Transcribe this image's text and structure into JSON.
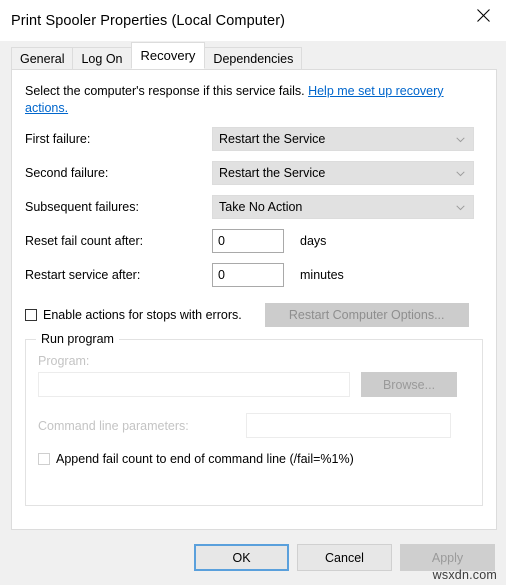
{
  "window": {
    "title": "Print Spooler Properties (Local Computer)",
    "close_icon": "close-icon"
  },
  "tabs": [
    {
      "label": "General",
      "active": false
    },
    {
      "label": "Log On",
      "active": false
    },
    {
      "label": "Recovery",
      "active": true
    },
    {
      "label": "Dependencies",
      "active": false
    }
  ],
  "intro": {
    "text": "Select the computer's response if this service fails.",
    "link": "Help me set up recovery actions."
  },
  "fields": {
    "first_failure": {
      "label": "First failure:",
      "value": "Restart the Service"
    },
    "second_failure": {
      "label": "Second failure:",
      "value": "Restart the Service"
    },
    "subsequent_failures": {
      "label": "Subsequent failures:",
      "value": "Take No Action"
    },
    "reset_fail_count": {
      "label": "Reset fail count after:",
      "value": "0",
      "unit": "days"
    },
    "restart_service_after": {
      "label": "Restart service after:",
      "value": "0",
      "unit": "minutes"
    }
  },
  "enable_actions": {
    "label": "Enable actions for stops with errors.",
    "checked": false,
    "button": "Restart Computer Options..."
  },
  "run_program": {
    "title": "Run program",
    "program_label": "Program:",
    "program_value": "",
    "program_placeholder": "",
    "browse_button": "Browse...",
    "cmd_label": "Command line parameters:",
    "cmd_value": "",
    "cmd_placeholder": "",
    "append_label": "Append fail count to end of command line (/fail=%1%)",
    "append_checked": false
  },
  "footer": {
    "ok": "OK",
    "cancel": "Cancel",
    "apply": "Apply",
    "watermark": "wsxdn.com"
  },
  "colors": {
    "accent": "#5aa0dc",
    "link": "#0066cc",
    "window_bg": "#f0f0f0",
    "panel_bg": "#ffffff",
    "disabled_text": "#9a9a9a"
  }
}
